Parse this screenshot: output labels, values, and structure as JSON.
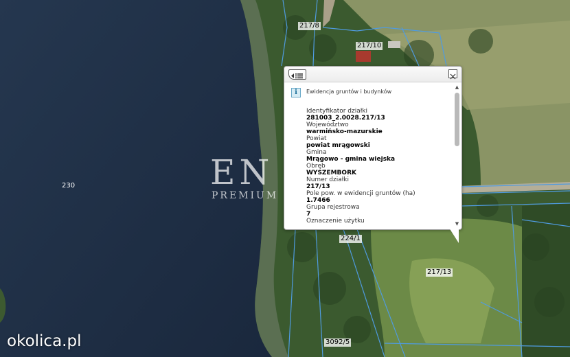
{
  "map": {
    "parcel_labels": [
      "217/8",
      "217/10",
      "230",
      "224/1",
      "217/13",
      "3092/5"
    ],
    "watermark": {
      "main": "EN CASA",
      "sub": "PREMIUM REAL ESTATE"
    },
    "logo": "okolica.pl"
  },
  "popup": {
    "layer_title": "Ewidencja gruntów i budynków",
    "icon": "info-icon",
    "attributes": [
      {
        "label": "Identyfikator działki",
        "value": "281003_2.0028.217/13"
      },
      {
        "label": "Województwo",
        "value": "warmińsko-mazurskie"
      },
      {
        "label": "Powiat",
        "value": "powiat mrągowski"
      },
      {
        "label": "Gmina",
        "value": "Mrągowo - gmina wiejska"
      },
      {
        "label": "Obręb",
        "value": "WYSZEMBORK"
      },
      {
        "label": "Numer działki",
        "value": "217/13"
      },
      {
        "label": "Pole pow. w ewidencji gruntów (ha)",
        "value": "1.7466"
      },
      {
        "label": "Grupa rejestrowa",
        "value": "7"
      },
      {
        "label": "Oznaczenie użytku",
        "value": ""
      }
    ]
  },
  "colors": {
    "water": "#1c2c44",
    "forest": "#3d5a30",
    "field": "#7a8e5a",
    "parcel_line": "#4f9be0"
  }
}
